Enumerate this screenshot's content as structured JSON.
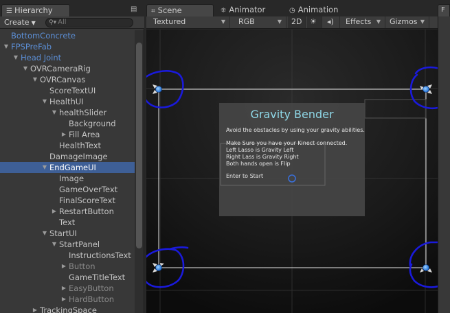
{
  "hierarchy": {
    "tab_label": "Hierarchy",
    "create_label": "Create",
    "search_placeholder": "All",
    "items": [
      {
        "label": "BottomConcrete",
        "indent": 0,
        "arrow": "",
        "style": "blue"
      },
      {
        "label": "FPSPreFab",
        "indent": 0,
        "arrow": "down",
        "style": "blue"
      },
      {
        "label": "Head Joint",
        "indent": 1,
        "arrow": "down",
        "style": "blue"
      },
      {
        "label": "OVRCameraRig",
        "indent": 2,
        "arrow": "down",
        "style": ""
      },
      {
        "label": "OVRCanvas",
        "indent": 3,
        "arrow": "down",
        "style": ""
      },
      {
        "label": "ScoreTextUI",
        "indent": 4,
        "arrow": "",
        "style": ""
      },
      {
        "label": "HealthUI",
        "indent": 4,
        "arrow": "down",
        "style": ""
      },
      {
        "label": "healthSlider",
        "indent": 5,
        "arrow": "down",
        "style": ""
      },
      {
        "label": "Background",
        "indent": 6,
        "arrow": "",
        "style": ""
      },
      {
        "label": "Fill Area",
        "indent": 6,
        "arrow": "right",
        "style": ""
      },
      {
        "label": "HealthText",
        "indent": 5,
        "arrow": "",
        "style": ""
      },
      {
        "label": "DamageImage",
        "indent": 4,
        "arrow": "",
        "style": ""
      },
      {
        "label": "EndGameUI",
        "indent": 4,
        "arrow": "down",
        "style": "sel"
      },
      {
        "label": "Image",
        "indent": 5,
        "arrow": "",
        "style": ""
      },
      {
        "label": "GameOverText",
        "indent": 5,
        "arrow": "",
        "style": ""
      },
      {
        "label": "FinalScoreText",
        "indent": 5,
        "arrow": "",
        "style": ""
      },
      {
        "label": "RestartButton",
        "indent": 5,
        "arrow": "right",
        "style": ""
      },
      {
        "label": "Text",
        "indent": 5,
        "arrow": "",
        "style": ""
      },
      {
        "label": "StartUI",
        "indent": 4,
        "arrow": "down",
        "style": ""
      },
      {
        "label": "StartPanel",
        "indent": 5,
        "arrow": "down",
        "style": ""
      },
      {
        "label": "InstructionsText",
        "indent": 6,
        "arrow": "",
        "style": ""
      },
      {
        "label": "Button",
        "indent": 6,
        "arrow": "right",
        "style": "dim"
      },
      {
        "label": "GameTitleText",
        "indent": 6,
        "arrow": "",
        "style": ""
      },
      {
        "label": "EasyButton",
        "indent": 6,
        "arrow": "right",
        "style": "dim"
      },
      {
        "label": "HardButton",
        "indent": 6,
        "arrow": "right",
        "style": "dim"
      },
      {
        "label": "TrackingSpace",
        "indent": 3,
        "arrow": "right",
        "style": ""
      }
    ]
  },
  "tabs": {
    "scene": "Scene",
    "animator": "Animator",
    "animation": "Animation",
    "right_stub": "F"
  },
  "scene_toolbar": {
    "shading": "Textured",
    "render_mode": "RGB",
    "mode_2d": "2D",
    "lighting_icon": "sun-icon",
    "audio_icon": "speaker-icon",
    "effects": "Effects",
    "gizmos": "Gizmos"
  },
  "canvas_panel": {
    "title": "Gravity Bender",
    "subtitle": "Avoid the obstacles by using your gravity abilities.",
    "line1": "Make Sure you have your Kinect connected.",
    "line2": "Left Lasso is Gravity Left",
    "line3": "Right Lass is Gravity Right",
    "line4": "Both hands open is Flip",
    "line5": "Enter to Start"
  },
  "colors": {
    "selection": "#3e5f96",
    "prefab_blue": "#5c8fd6",
    "annotation_ink": "#1a1adc",
    "title_cyan": "#8fd8e8"
  }
}
